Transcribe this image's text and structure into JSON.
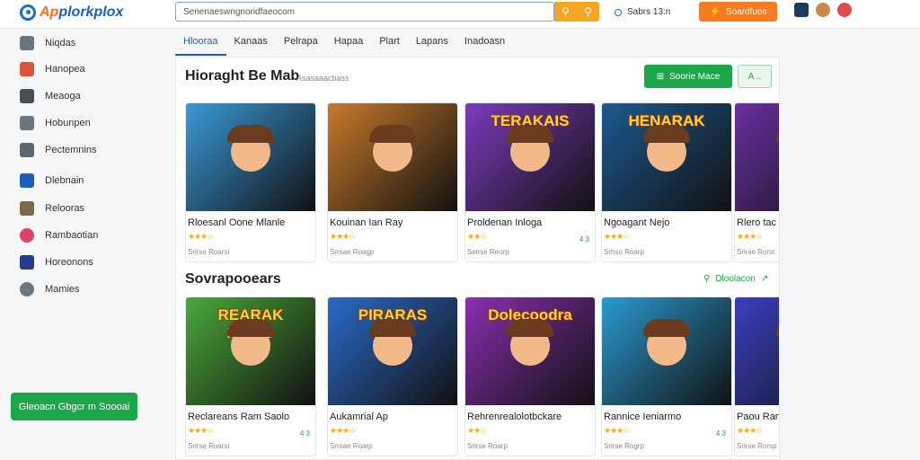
{
  "header": {
    "logo_text_a": "Ap",
    "logo_text_b": "plorkplox",
    "search_placeholder": "Senenaeswngnoridfaeocom",
    "status_text": "Sabrs 13:n",
    "cta_label": "Soardfuos"
  },
  "sidebar": {
    "items": [
      {
        "label": "Niqdas",
        "icon": "home-icon"
      },
      {
        "label": "Hanopea",
        "icon": "star-icon"
      },
      {
        "label": "Meaoga",
        "icon": "gamepad-icon"
      },
      {
        "label": "Hobunpen",
        "icon": "bookmark-icon"
      },
      {
        "label": "Pectemnins",
        "icon": "calendar-icon"
      },
      {
        "label": "Dlebnain",
        "icon": "grid-icon"
      },
      {
        "label": "Relooras",
        "icon": "image-icon"
      },
      {
        "label": "Rambaotian",
        "icon": "puzzle-icon"
      },
      {
        "label": "Horeonons",
        "icon": "monitor-icon"
      },
      {
        "label": "Mamies",
        "icon": "settings-icon"
      }
    ],
    "cta_label": "Gleoacn Gbgcr m Soooai"
  },
  "tabs": [
    {
      "label": "Hlooraa",
      "active": true
    },
    {
      "label": "Kanaas",
      "active": false
    },
    {
      "label": "Pelrapa",
      "active": false
    },
    {
      "label": "Hapaa",
      "active": false
    },
    {
      "label": "Plart",
      "active": false
    },
    {
      "label": "Lapans",
      "active": false
    },
    {
      "label": "Inadoasn",
      "active": false
    }
  ],
  "section1": {
    "title": "Hioraght Be Mab",
    "subtitle": "Asasaaacbass",
    "green_button": "Soorie Mace",
    "ghost_button": "A ..",
    "cards": [
      {
        "name": "Rloesanl Oone Mlanle",
        "stars": "★★★☆",
        "meta": "Srirse Roarsi",
        "badge": "",
        "banner": "",
        "bg": "#3a9ad9"
      },
      {
        "name": "Kouinan Ian Ray",
        "stars": "★★★☆",
        "meta": "Srrsae Roagp",
        "badge": "",
        "banner": "",
        "bg": "#c97a2a"
      },
      {
        "name": "Proldenan Inloga",
        "stars": "★★☆",
        "meta": "Seirse Reorp",
        "badge": "4 3",
        "banner": "TERAKAIS",
        "bg": "#7c3bbd"
      },
      {
        "name": "Ngoagant Nejo",
        "stars": "★★★☆",
        "meta": "Srhso Roarp",
        "badge": "",
        "banner": "HENARAK",
        "bg": "#1b5a8f"
      },
      {
        "name": "Rlero tac",
        "stars": "★★★☆",
        "meta": "Srirse Rorst",
        "badge": "",
        "banner": "",
        "bg": "#6a2fa0"
      }
    ]
  },
  "section2": {
    "title": "Sovrapooears",
    "see_all": "Dloolacon",
    "cards": [
      {
        "name": "Reclareans Ram Saolo",
        "stars": "★★★☆",
        "meta": "Srirse Roarsi",
        "badge": "4 3",
        "banner": "REARAK MAGO",
        "bg": "#4aa93a"
      },
      {
        "name": "Aukamrial Ap",
        "stars": "★★★☆",
        "meta": "Srrsae Roarp",
        "badge": "",
        "banner": "PIRARAS",
        "bg": "#2b6ac9"
      },
      {
        "name": "Rehrenrealolotbckare",
        "stars": "★★☆",
        "meta": "Srirse Roarp",
        "badge": "",
        "banner": "Dolecoodra",
        "bg": "#8a2fb0"
      },
      {
        "name": "Rannice Ieniarmo",
        "stars": "★★★☆",
        "meta": "Srirse Rogrp",
        "badge": "4 3",
        "banner": "",
        "bg": "#2a9ad0"
      },
      {
        "name": "Paou Ran",
        "stars": "★★★☆",
        "meta": "Srirse Rorsp",
        "badge": "",
        "banner": "",
        "bg": "#3b3fc0"
      }
    ]
  }
}
